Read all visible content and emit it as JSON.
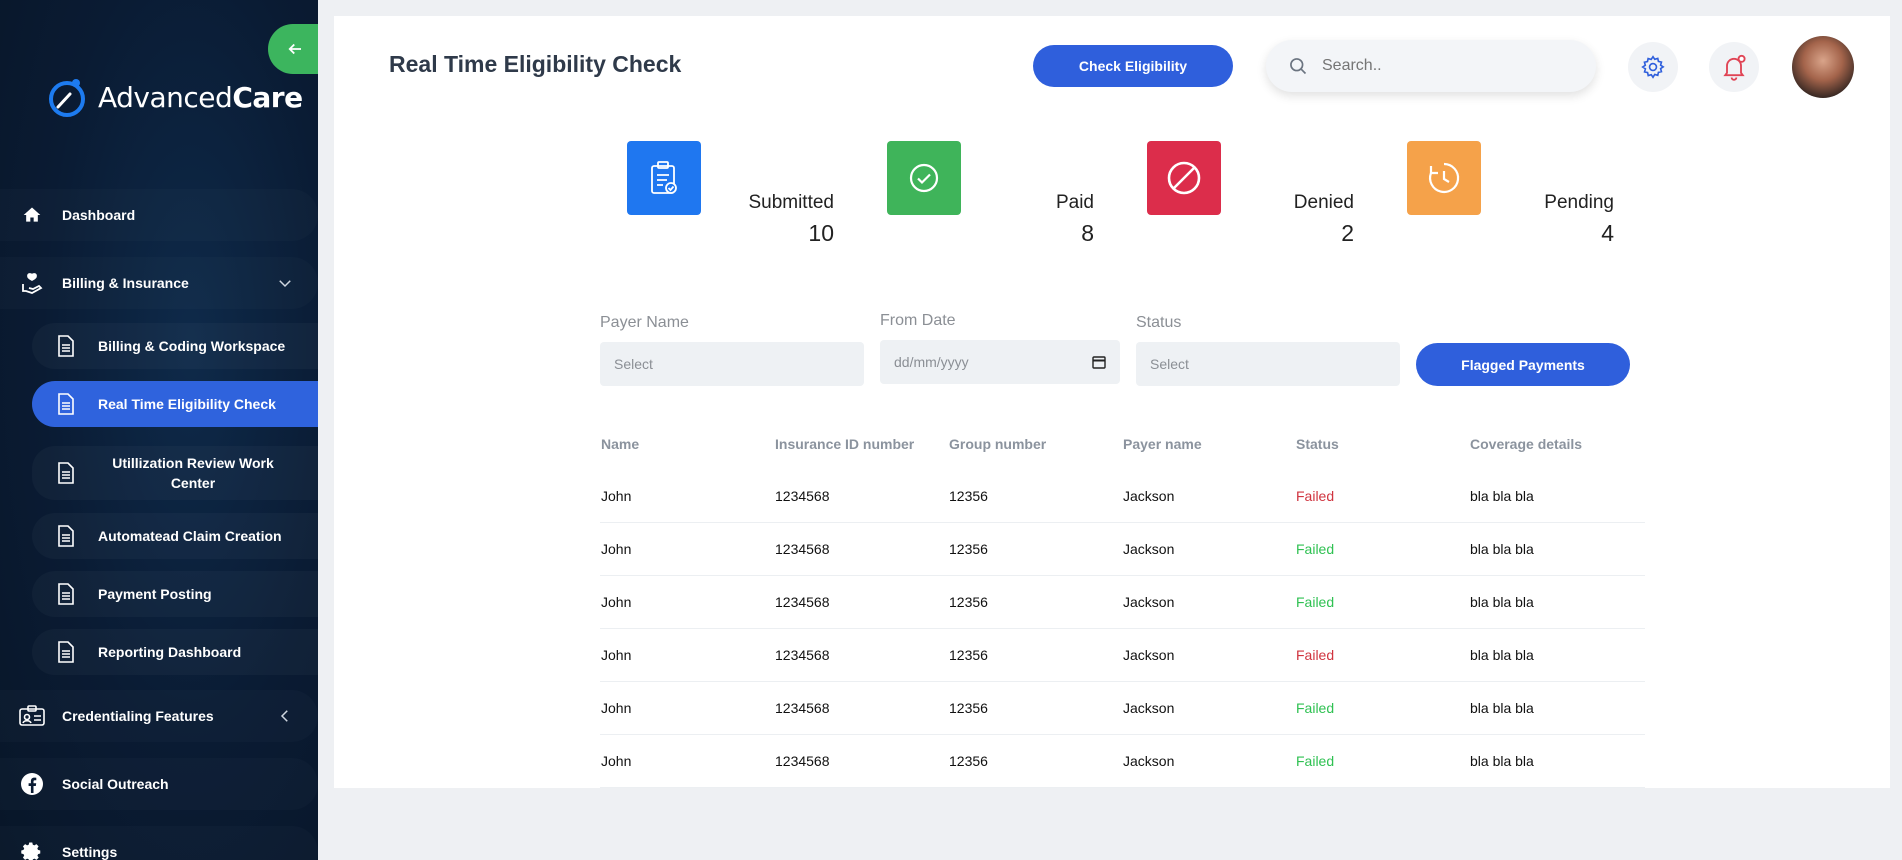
{
  "app": {
    "brand_prefix": "Advanced",
    "brand_suffix": "Care"
  },
  "sidebar": {
    "items": [
      {
        "label": "Dashboard",
        "icon": "home-icon"
      },
      {
        "label": "Billing & Insurance",
        "icon": "hand-heart-icon",
        "expanded": true
      },
      {
        "label": "Billing & Coding Workspace",
        "icon": "document-icon"
      },
      {
        "label": "Real Time Eligibility Check",
        "icon": "document-icon",
        "active": true
      },
      {
        "label": "Utillization Review Work Center",
        "icon": "document-icon"
      },
      {
        "label": "Automatead Claim Creation",
        "icon": "document-icon"
      },
      {
        "label": "Payment Posting",
        "icon": "document-icon"
      },
      {
        "label": "Reporting Dashboard",
        "icon": "document-icon"
      },
      {
        "label": "Credentialing Features",
        "icon": "id-card-icon"
      },
      {
        "label": "Social Outreach",
        "icon": "facebook-icon"
      },
      {
        "label": "Settings",
        "icon": "gear-icon"
      }
    ]
  },
  "header": {
    "title": "Real Time Eligibility Check",
    "check_button": "Check Eligibility",
    "search_placeholder": "Search.."
  },
  "stats": [
    {
      "label": "Submitted",
      "value": "10",
      "color": "#1f77f0"
    },
    {
      "label": "Paid",
      "value": "8",
      "color": "#3fb45a"
    },
    {
      "label": "Denied",
      "value": "2",
      "color": "#dc2d4b"
    },
    {
      "label": "Pending",
      "value": "4",
      "color": "#f5a24a"
    }
  ],
  "filters": {
    "payer_label": "Payer Name",
    "payer_value": "Select",
    "from_label": "From Date",
    "from_value": "dd/mm/yyyy",
    "status_label": "Status",
    "status_value": "Select",
    "flagged_button": "Flagged Payments"
  },
  "table": {
    "headers": [
      "Name",
      "Insurance ID number",
      "Group number",
      "Payer name",
      "Status",
      "Coverage details"
    ],
    "rows": [
      {
        "name": "John",
        "insurance_id": "1234568",
        "group": "12356",
        "payer": "Jackson",
        "status": "Failed",
        "status_color": "red",
        "coverage": "bla bla bla"
      },
      {
        "name": "John",
        "insurance_id": "1234568",
        "group": "12356",
        "payer": "Jackson",
        "status": "Failed",
        "status_color": "green",
        "coverage": "bla bla bla"
      },
      {
        "name": "John",
        "insurance_id": "1234568",
        "group": "12356",
        "payer": "Jackson",
        "status": "Failed",
        "status_color": "green",
        "coverage": "bla bla bla"
      },
      {
        "name": "John",
        "insurance_id": "1234568",
        "group": "12356",
        "payer": "Jackson",
        "status": "Failed",
        "status_color": "red",
        "coverage": "bla bla bla"
      },
      {
        "name": "John",
        "insurance_id": "1234568",
        "group": "12356",
        "payer": "Jackson",
        "status": "Failed",
        "status_color": "green",
        "coverage": "bla bla bla"
      },
      {
        "name": "John",
        "insurance_id": "1234568",
        "group": "12356",
        "payer": "Jackson",
        "status": "Failed",
        "status_color": "green",
        "coverage": "bla bla bla"
      }
    ]
  },
  "colors": {
    "accent": "#2f5fdc",
    "sidebar_bg": "#0a1b33",
    "collapse_green": "#3cb55e"
  }
}
